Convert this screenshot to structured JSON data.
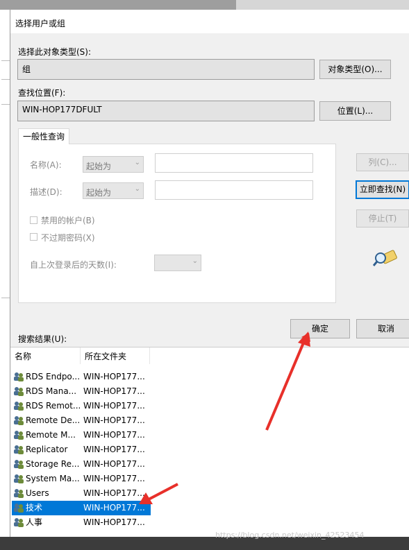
{
  "dialog": {
    "title": "选择用户或组"
  },
  "object_type": {
    "label": "选择此对象类型(S):",
    "value": "组",
    "button": "对象类型(O)..."
  },
  "location": {
    "label": "查找位置(F):",
    "value": "WIN-HOP177DFULT",
    "button": "位置(L)..."
  },
  "query_tab": {
    "label": "一般性查询",
    "name_label": "名称(A):",
    "name_combo": "起始为",
    "desc_label": "描述(D):",
    "desc_combo": "起始为",
    "disabled_accounts": "禁用的帐户(B)",
    "non_expiring_pw": "不过期密码(X)",
    "days_since_login": "自上次登录后的天数(I):"
  },
  "side_buttons": {
    "columns": "列(C)...",
    "find_now": "立即查找(N)",
    "stop": "停止(T)"
  },
  "actions": {
    "ok": "确定",
    "cancel": "取消"
  },
  "results": {
    "label": "搜索结果(U):",
    "col_name": "名称",
    "col_folder": "所在文件夹",
    "rows": [
      {
        "name": "RDS Endpo...",
        "folder": "WIN-HOP177..."
      },
      {
        "name": "RDS Mana...",
        "folder": "WIN-HOP177..."
      },
      {
        "name": "RDS Remot...",
        "folder": "WIN-HOP177..."
      },
      {
        "name": "Remote De...",
        "folder": "WIN-HOP177..."
      },
      {
        "name": "Remote M...",
        "folder": "WIN-HOP177..."
      },
      {
        "name": "Replicator",
        "folder": "WIN-HOP177..."
      },
      {
        "name": "Storage Re...",
        "folder": "WIN-HOP177..."
      },
      {
        "name": "System Ma...",
        "folder": "WIN-HOP177..."
      },
      {
        "name": "Users",
        "folder": "WIN-HOP177..."
      },
      {
        "name": "技术",
        "folder": "WIN-HOP177...",
        "selected": true
      },
      {
        "name": "人事",
        "folder": "WIN-HOP177..."
      }
    ]
  },
  "watermark": "https://blog.csdn.net/weixin_42523454",
  "colors": {
    "selection": "#0078d7",
    "annotation_arrow": "#e8302a"
  }
}
